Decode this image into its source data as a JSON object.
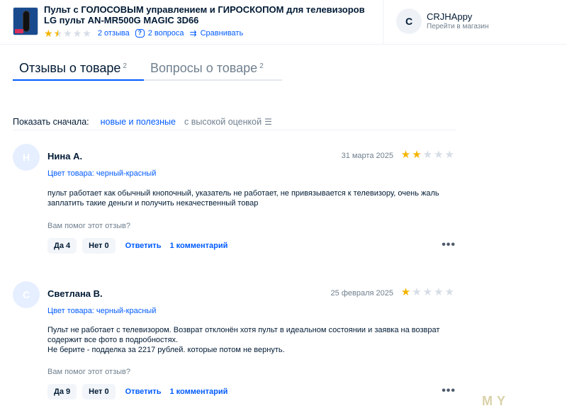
{
  "product": {
    "title": "Пульт с ГОЛОСОВЫМ управлением и ГИРОСКОПОМ для телевизоров LG пульт AN-MR500G MAGIC 3D66",
    "rating": 1.5,
    "reviews_link": "2 отзыва",
    "questions_link": "2 вопроса",
    "compare_link": "Сравнивать"
  },
  "seller": {
    "avatar_letter": "C",
    "name": "CRJHAppy",
    "link": "Перейти в магазин"
  },
  "tabs": [
    {
      "label": "Отзывы о товаре",
      "count": "2",
      "active": true
    },
    {
      "label": "Вопросы о товаре",
      "count": "2",
      "active": false
    }
  ],
  "sort": {
    "label": "Показать сначала:",
    "options": [
      "новые и полезные",
      "с высокой оценкой"
    ]
  },
  "reviews": [
    {
      "avatar_letter": "Н",
      "name": "Нина А.",
      "date": "31 марта 2025",
      "rating": 2,
      "color": "Цвет товара: черный-красный",
      "text_lines": [
        "пульт работает как обычный кнопочный, указатель не работает, не привязывается к телевизору, очень жаль",
        "заплатить такие деньги и получить некачественный товар"
      ],
      "helpful": "Вам помог этот отзыв?",
      "yes": "Да 4",
      "no": "Нет 0",
      "reply": "Ответить",
      "comments": "1 комментарий"
    },
    {
      "avatar_letter": "С",
      "name": "Светлана В.",
      "date": "25 февраля 2025",
      "rating": 1,
      "color": "Цвет товара: черный-красный",
      "text_lines": [
        "Пульт не работает с телевизором. Возврат отклонён хотя пульт в идеальном состоянии и заявка на возврат",
        "содержит все фото в подробностях.",
        "Не берите - подделка за 2217 рублей. которые потом не вернуть."
      ],
      "helpful": "Вам помог этот отзыв?",
      "yes": "Да 9",
      "no": "Нет 0",
      "reply": "Ответить",
      "comments": "1 комментарий"
    }
  ],
  "watermark": "MY",
  "colors": {
    "accent": "#005bff",
    "star": "#f5b400",
    "text": "#001a34",
    "muted": "#70808f"
  }
}
